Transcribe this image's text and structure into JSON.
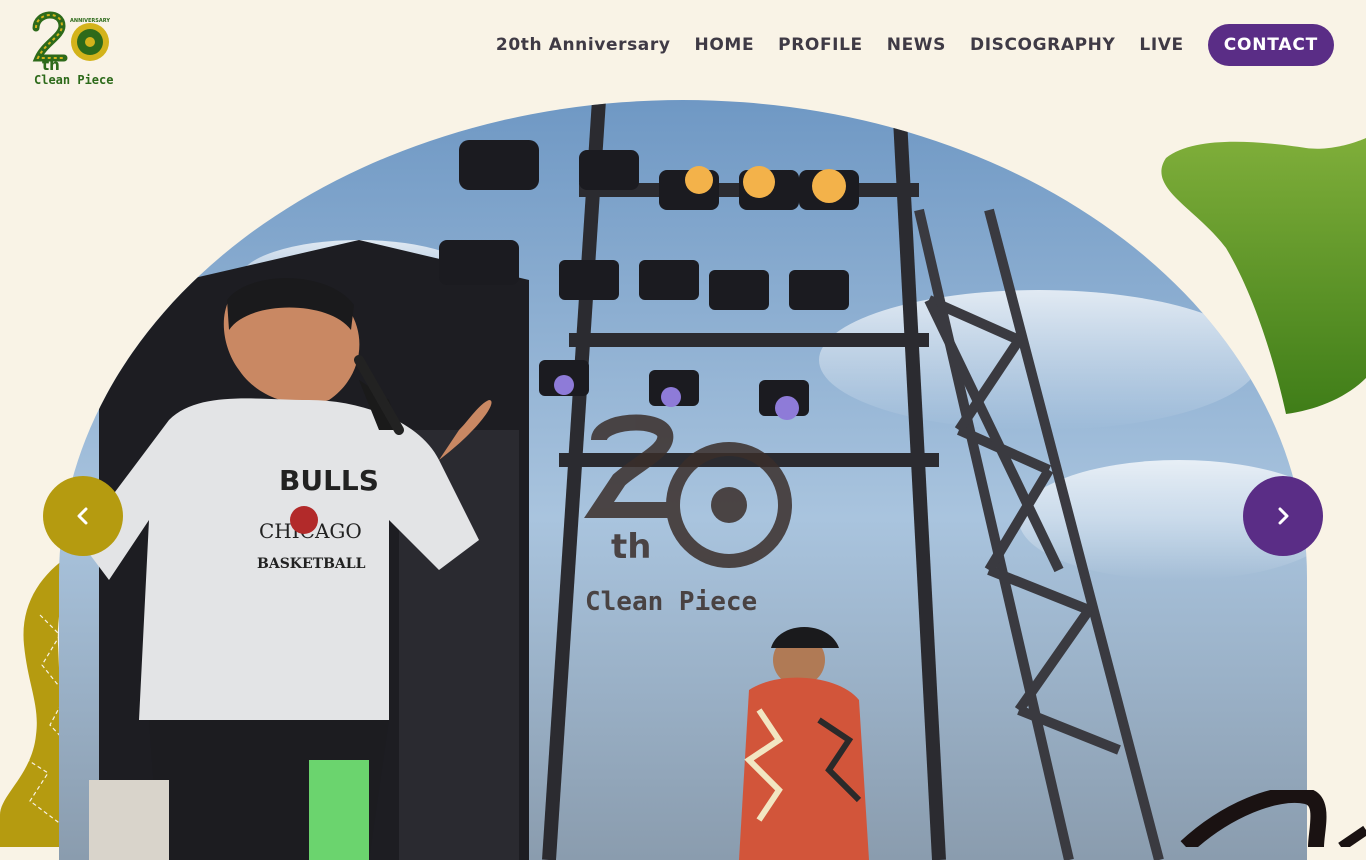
{
  "header": {
    "logo": {
      "alt": "20th Anniversary Clean Piece",
      "badge_text": "ANNIVERSARY",
      "suffix": "th",
      "wordmark": "Clean Piece"
    },
    "nav": [
      {
        "label": "20th Anniversary"
      },
      {
        "label": "HOME"
      },
      {
        "label": "PROFILE"
      },
      {
        "label": "NEWS"
      },
      {
        "label": "DISCOGRAPHY"
      },
      {
        "label": "LIVE"
      }
    ],
    "contact_label": "CONTACT"
  },
  "hero": {
    "overlay_logo": {
      "suffix": "th",
      "wordmark": "Clean Piece"
    },
    "shirt_text": {
      "top": "BULLS",
      "middle": "CHICAGO",
      "bottom": "BASKETBALL"
    }
  },
  "slider": {
    "prev_icon": "chevron-left-icon",
    "next_icon": "chevron-right-icon"
  },
  "colors": {
    "background": "#f9f3e6",
    "accent_purple": "#5a2d86",
    "accent_yellow": "#b59b10",
    "accent_green": "#4a8a1c",
    "nav_text": "#3f3a45"
  }
}
